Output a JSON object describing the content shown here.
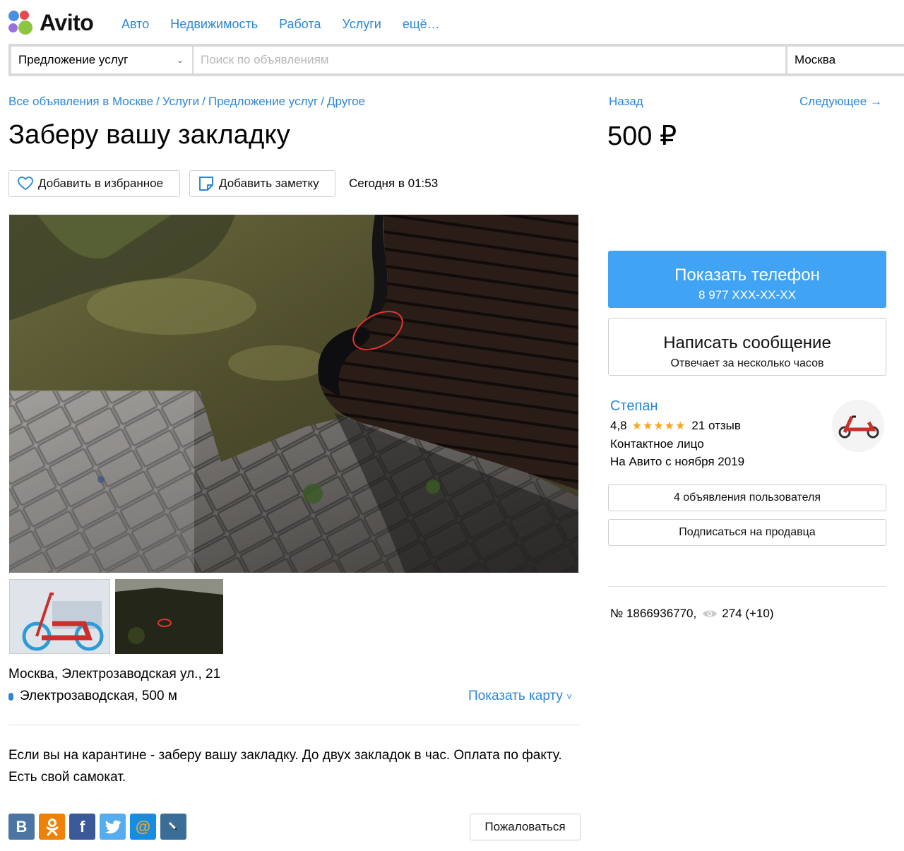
{
  "header": {
    "logo_text": "Avito",
    "nav": [
      "Авто",
      "Недвижимость",
      "Работа",
      "Услуги",
      "ещё…"
    ]
  },
  "search": {
    "category": "Предложение услуг",
    "placeholder": "Поиск по объявлениям",
    "city": "Москва"
  },
  "breadcrumbs": [
    "Все объявления в Москве",
    "Услуги",
    "Предложение услуг",
    "Другое"
  ],
  "navigation": {
    "back": "Назад",
    "next": "Следующее →"
  },
  "listing": {
    "title": "Заберу вашу закладку",
    "price": "500 ₽",
    "favorite_label": "Добавить в избранное",
    "note_label": "Добавить заметку",
    "posted": "Сегодня в 01:53",
    "address": "Москва, Электрозаводская ул., 21",
    "metro": "Электрозаводская, 500 м",
    "show_map": "Показать карту",
    "description": "Если вы на карантине - заберу вашу закладку. До двух закладок в час. Оплата по факту. Есть свой самокат.",
    "report_label": "Пожаловаться",
    "number": "№ 1866936770,",
    "views": "274 (+10)"
  },
  "share": [
    {
      "name": "vk",
      "glyph": "B",
      "color": "#4c75a3"
    },
    {
      "name": "ok",
      "glyph": "ok",
      "color": "#ee8208"
    },
    {
      "name": "facebook",
      "glyph": "f",
      "color": "#3b5998"
    },
    {
      "name": "twitter",
      "glyph": "tw",
      "color": "#55acee"
    },
    {
      "name": "mail",
      "glyph": "@",
      "color": "#168de2"
    },
    {
      "name": "livejournal",
      "glyph": "lj",
      "color": "#3a6e96"
    }
  ],
  "sidebar": {
    "phone_title": "Показать телефон",
    "phone_number": "8 977 XXX-XX-XX",
    "message_title": "Написать сообщение",
    "message_sub": "Отвечает за несколько часов",
    "seller_name": "Степан",
    "rating": "4,8",
    "stars": 5,
    "reviews": "21 отзыв",
    "seller_type": "Контактное лицо",
    "seller_since": "На Авито с ноября 2019",
    "ads_label": "4 объявления пользователя",
    "subscribe_label": "Подписаться на продавца"
  },
  "colors": {
    "accent": "#2e86d4",
    "phone_button": "#40a3f4",
    "stars": "#f5a623"
  }
}
